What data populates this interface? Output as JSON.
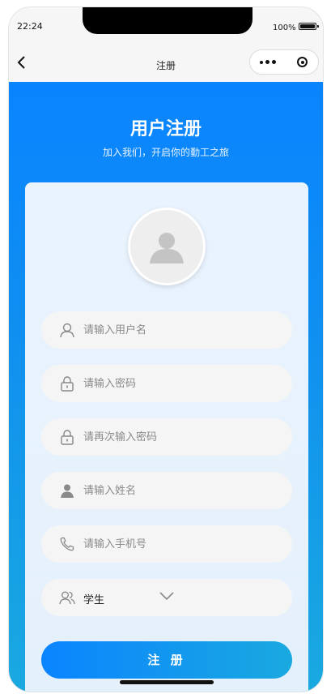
{
  "status": {
    "time": "22:24",
    "battery": "100%"
  },
  "navbar": {
    "title": "注册"
  },
  "header": {
    "title": "用户注册",
    "subtitle": "加入我们，开启你的勤工之旅"
  },
  "form": {
    "username_placeholder": "请输入用户名",
    "password_placeholder": "请输入密码",
    "confirm_placeholder": "请再次输入密码",
    "name_placeholder": "请输入姓名",
    "phone_placeholder": "请输入手机号",
    "role_value": "学生",
    "submit_label": "注 册"
  },
  "colors": {
    "accent": "#0a84ff",
    "accent_end": "#1aa9e0"
  }
}
